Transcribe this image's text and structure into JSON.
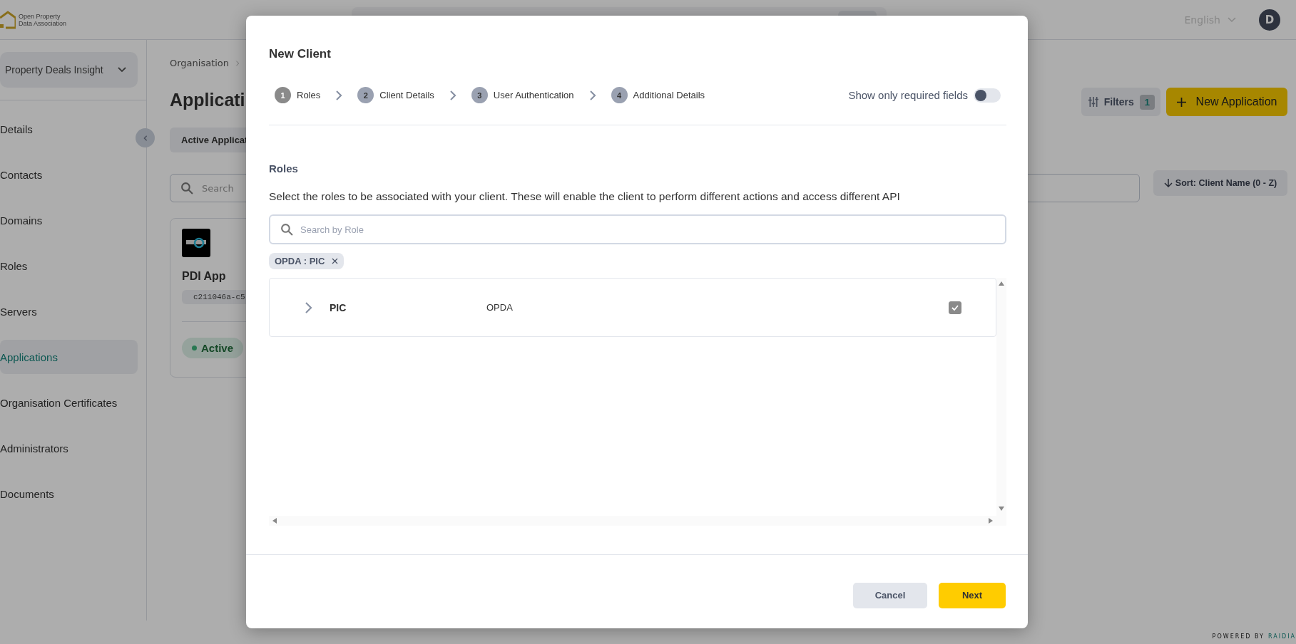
{
  "header": {
    "logo_lines": [
      "Open Property",
      "Data Association"
    ],
    "language": "English",
    "avatar": "D"
  },
  "sidebar": {
    "organisation": "Property Deals Insight",
    "items": [
      {
        "label": "Details",
        "selected": false
      },
      {
        "label": "Contacts",
        "selected": false
      },
      {
        "label": "Domains",
        "selected": false
      },
      {
        "label": "Roles",
        "selected": false
      },
      {
        "label": "Servers",
        "selected": false
      },
      {
        "label": "Applications",
        "selected": true
      },
      {
        "label": "Organisation Certificates",
        "selected": false
      },
      {
        "label": "Administrators",
        "selected": false
      },
      {
        "label": "Documents",
        "selected": false
      }
    ]
  },
  "main": {
    "breadcrumb": [
      "Organisation"
    ],
    "title": "Applicati",
    "tabs": [
      {
        "label": "Active Applicat",
        "selected": true
      }
    ],
    "filters": {
      "label": "Filters",
      "count": "1"
    },
    "new_button": "New Application",
    "search": {
      "placeholder": "Search"
    },
    "sort": "Sort: Client Name (0 - Z)",
    "cards": [
      {
        "name": "PDI App",
        "client_id": "c211046a-c5",
        "status": "Active"
      }
    ]
  },
  "modal": {
    "title": "New Client",
    "steps": [
      {
        "number": "1",
        "label": "Roles",
        "selected": true
      },
      {
        "number": "2",
        "label": "Client Details",
        "selected": false
      },
      {
        "number": "3",
        "label": "User Authentication",
        "selected": false
      },
      {
        "number": "4",
        "label": "Additional Details",
        "selected": false
      }
    ],
    "required_toggle": {
      "label": "Show only required fields",
      "on": false
    },
    "section_title": "Roles",
    "description": "Select the roles to be associated with your client. These will enable the client to perform different actions and access different API",
    "search": {
      "placeholder": "Search by Role"
    },
    "chips": [
      {
        "label": "OPDA : PIC"
      }
    ],
    "roles": [
      {
        "name": "PIC",
        "organisation": "OPDA",
        "expanded": false,
        "checked": true
      }
    ],
    "buttons": [
      {
        "label": "Cancel",
        "kind": "secondary"
      },
      {
        "label": "Next",
        "kind": "primary"
      }
    ]
  },
  "footer": {
    "powered_by": "POWERED BY",
    "brand": "RAIDIA"
  }
}
